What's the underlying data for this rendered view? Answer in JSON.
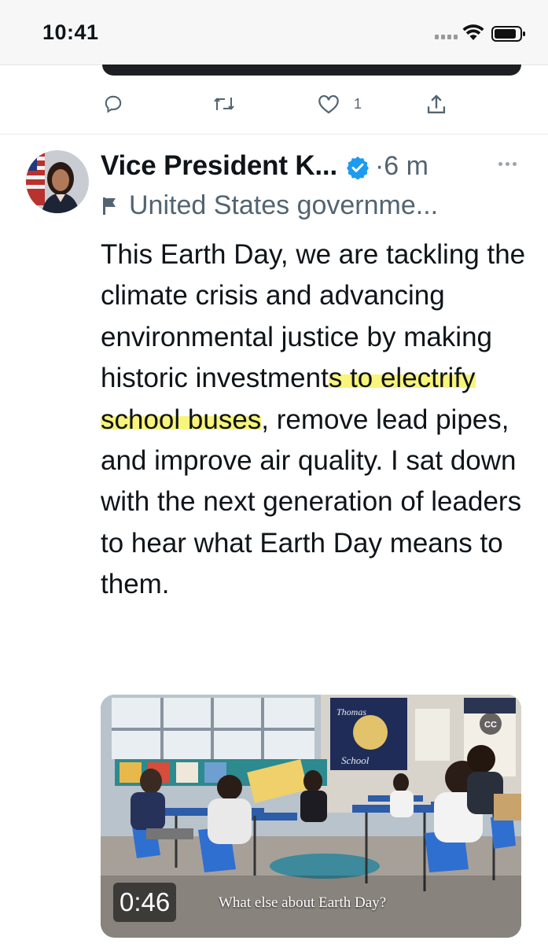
{
  "status_bar": {
    "time": "10:41"
  },
  "previous_tweet": {
    "like_count": "1"
  },
  "tweet": {
    "display_name": "Vice President K...",
    "timestamp": "·6 m",
    "affiliation": "United States governme...",
    "text_before": "This Earth Day, we are tackling the climate crisis and advancing environmental justice by making historic investment",
    "text_highlight": "s to electrify school buses",
    "text_after": ", remove lead pipes, and improve air quality. I sat down with the next generation of leaders to hear what Earth Day means to them.",
    "highlight_color": "#f6f050",
    "verified_color": "#1d9bf0"
  },
  "video": {
    "duration": "0:46",
    "caption": "What else about Earth Day?",
    "sign_text": "Thomas Elementary School"
  }
}
